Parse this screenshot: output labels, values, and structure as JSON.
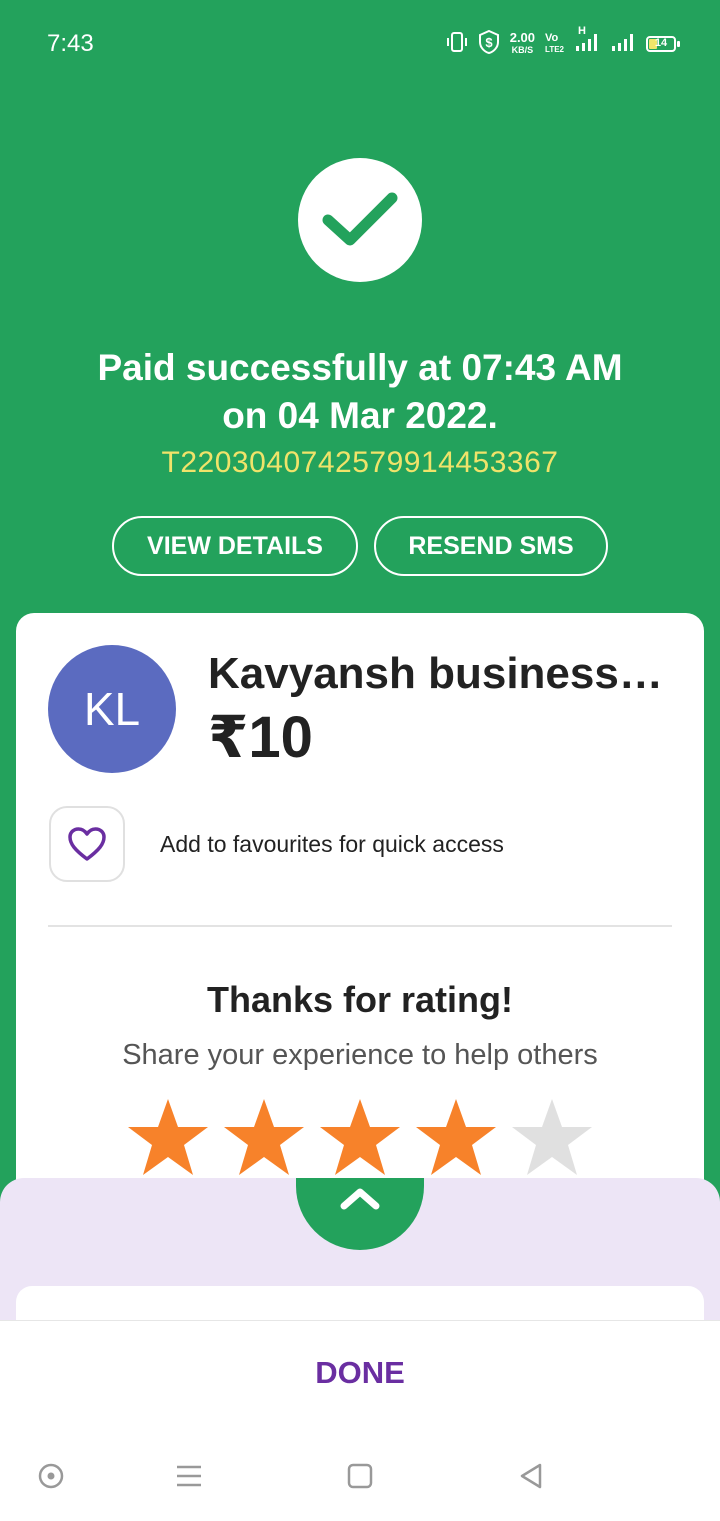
{
  "status_bar": {
    "time": "7:43",
    "net_speed_value": "2.00",
    "net_speed_unit": "KB/S",
    "volte": "Vo",
    "volte2": "LTE2",
    "network_type": "H",
    "battery_level": "14"
  },
  "payment": {
    "status_line1": "Paid successfully at 07:43 AM",
    "status_line2": "on 04 Mar 2022.",
    "transaction_id": "T2203040742579914453367",
    "view_details_label": "VIEW DETAILS",
    "resend_sms_label": "RESEND SMS"
  },
  "merchant": {
    "initials": "KL",
    "name": "Kavyansh business services",
    "amount": "₹10",
    "favourite_label": "Add to favourites for quick access"
  },
  "rating": {
    "title": "Thanks for rating!",
    "subtitle": "Share your experience to help others",
    "stars_filled": 4,
    "stars_total": 5
  },
  "footer": {
    "done_label": "DONE"
  },
  "colors": {
    "brand_green": "#23a25c",
    "accent_purple": "#6a2ea1",
    "avatar_blue": "#5b6bc0",
    "star_filled": "#f7822a",
    "star_empty": "#e0e0e0",
    "txn_yellow": "#f0e36a"
  }
}
